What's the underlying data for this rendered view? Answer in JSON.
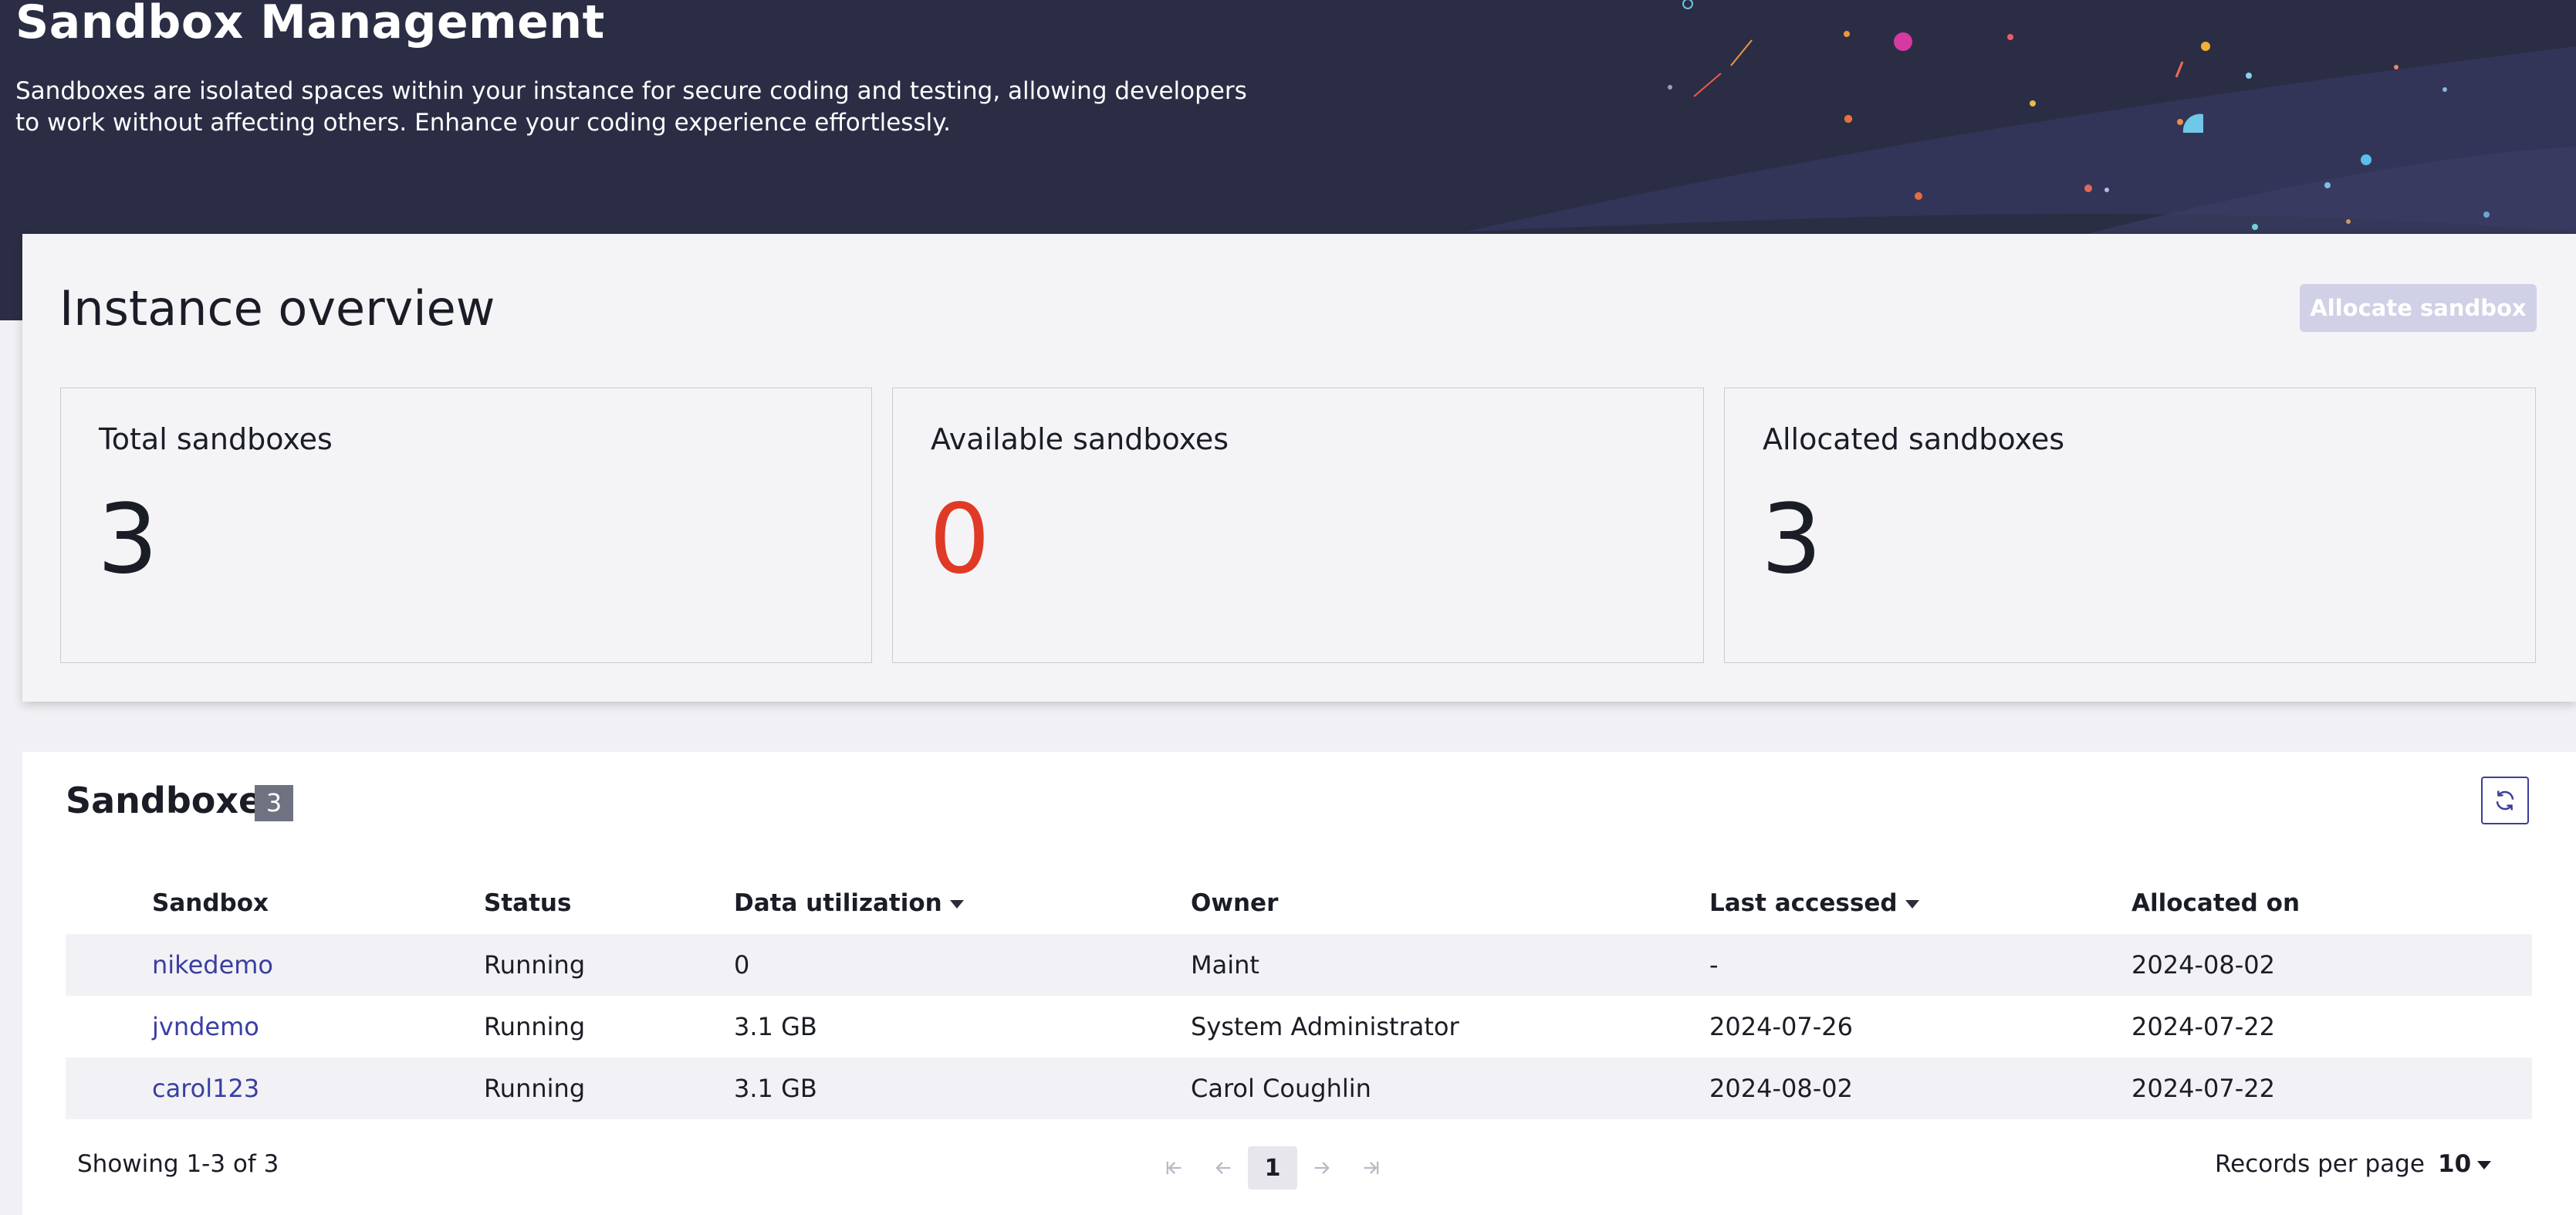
{
  "header": {
    "title": "Sandbox Management",
    "description": "Sandboxes are isolated spaces within your instance for secure coding and testing, allowing developers to work without affecting others. Enhance your coding experience effortlessly."
  },
  "overview": {
    "title": "Instance overview",
    "allocate_button": "Allocate sandbox",
    "stats": [
      {
        "label": "Total sandboxes",
        "value": "3"
      },
      {
        "label": "Available sandboxes",
        "value": "0"
      },
      {
        "label": "Allocated sandboxes",
        "value": "3"
      }
    ],
    "available_value_color": "#e03a26"
  },
  "sandboxes": {
    "title": "Sandboxes",
    "count": "3",
    "refresh_icon": "refresh-icon",
    "columns": [
      "Sandbox",
      "Status",
      "Data utilization",
      "Owner",
      "Last accessed",
      "Allocated on"
    ],
    "rows": [
      {
        "sandbox": "nikedemo",
        "status": "Running",
        "data": "0",
        "owner": "Maint",
        "last_accessed": "-",
        "allocated_on": "2024-08-02"
      },
      {
        "sandbox": "jvndemo",
        "status": "Running",
        "data": "3.1 GB",
        "owner": "System Administrator",
        "last_accessed": "2024-07-26",
        "allocated_on": "2024-07-22"
      },
      {
        "sandbox": "carol123",
        "status": "Running",
        "data": "3.1 GB",
        "owner": "Carol Coughlin",
        "last_accessed": "2024-08-02",
        "allocated_on": "2024-07-22"
      }
    ],
    "footer": {
      "showing": "Showing 1-3 of 3",
      "current_page": "1",
      "records_per_page_label": "Records per page",
      "records_per_page_value": "10"
    }
  },
  "colors": {
    "hero_bg": "#2b2d45",
    "link": "#3a3ea1",
    "accent_button": "#d0d0e6"
  }
}
